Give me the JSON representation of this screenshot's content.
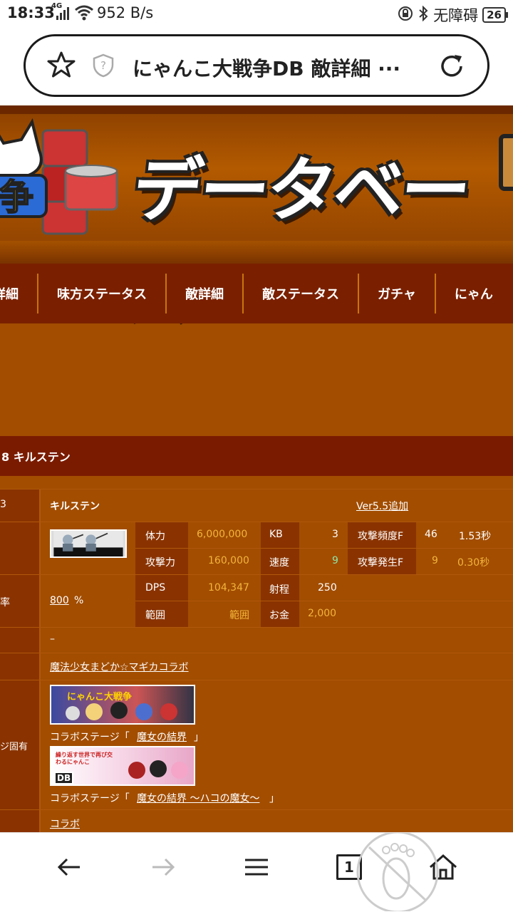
{
  "status_bar": {
    "time": "18:33",
    "network": "4G",
    "speed": "952 B/s",
    "accessibility": "无障碍",
    "battery": "26"
  },
  "address_bar": {
    "title": "にゃんこ大戦争DB 敵詳細 ···"
  },
  "header": {
    "logo_text": "データベース"
  },
  "nav": {
    "items": [
      "詳細",
      "味方ステータス",
      "敵詳細",
      "敵ステータス",
      "ガチャ",
      "にゃん"
    ]
  },
  "enemy": {
    "title": "8 キルステン",
    "name_label": "3",
    "name": "キルステン",
    "version": "Ver5.5追加",
    "rate_label": "率",
    "rate_value": "800",
    "rate_unit": "%",
    "stats": {
      "hp_label": "体力",
      "hp": "6,000,000",
      "kb_label": "KB",
      "kb": "3",
      "freq_label": "攻撃頻度F",
      "freq_f": "46",
      "freq_s": "1.53秒",
      "atk_label": "攻撃力",
      "atk": "160,000",
      "speed_label": "速度",
      "speed": "9",
      "occur_label": "攻撃発生F",
      "occur_f": "9",
      "occur_s": "0.30秒",
      "dps_label": "DPS",
      "dps": "104,347",
      "range_label": "射程",
      "range": "250",
      "area_label": "範囲",
      "area": "範囲",
      "money_label": "お金",
      "money": "2,000"
    },
    "ability": "–",
    "collab": "魔法少女まどか☆マギカコラボ",
    "stage_label": "ジ固有",
    "stage1_prefix": "コラボステージ「",
    "stage1_link": "魔女の結界",
    "stage1_suffix": "」",
    "stage2_prefix": "コラボステージ「",
    "stage2_link": "魔女の結界 ～ハコの魔女～",
    "stage2_suffix": "」",
    "category": "コラボ",
    "banner1_text1": "にゃんこ大戦争",
    "banner2_text1": "繰り返す世界で再び交わるにゃんこ",
    "banner2_db": "DB"
  },
  "bottom_nav": {
    "tab_count": "1"
  }
}
